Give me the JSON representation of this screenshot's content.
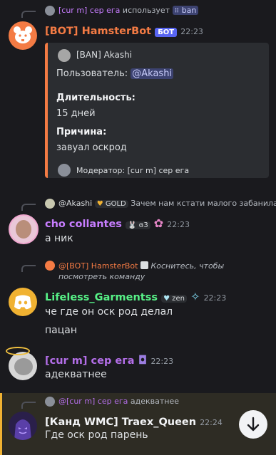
{
  "m1": {
    "reply_user": "[cur m] сер ега",
    "reply_text": "использует",
    "reply_cmd": "ban",
    "author": "[BOT] HamsterBot",
    "bot_badge": "БОТ",
    "time": "22:23",
    "embed": {
      "author": "[BAN] Akashi",
      "user_label": "Пользователь:",
      "user_mention": "@Akashi",
      "duration_label": "Длительность:",
      "duration_value": "15 дней",
      "reason_label": "Причина:",
      "reason_value": "завуал оскрод",
      "footer": "Модератор: [cur m] сер ега"
    }
  },
  "m2": {
    "reply_user": "@Akashi",
    "reply_tag": "GOLD",
    "reply_text": "Зачем нам кстати малого забанила",
    "author": "cho collantes",
    "tag": "ɞ3",
    "time": "22:23",
    "text": "а ник"
  },
  "m3": {
    "reply_user": "@[BOT] HamsterBot",
    "reply_text": "Коснитесь, чтобы посмотреть команду",
    "author": "Lifeless_Garmentss",
    "tag": "zen",
    "time": "22:23",
    "line1": "че где он оск род делал",
    "line2": "пацан"
  },
  "m4": {
    "author": "[cur m] сер ега",
    "time": "22:23",
    "text": "адекватнее"
  },
  "m5": {
    "reply_user": "@[cur m] сер ега",
    "reply_text": "адекватнее",
    "author": "[Канд WMC] Traex_Queen",
    "time": "22:24",
    "text": "Где оск род парень"
  },
  "colors": {
    "bot_name": "#f47b44",
    "embed_bar": "#f47b44",
    "mention_bg": "#3c4270",
    "mention_fg": "#c9cdfb",
    "cho": "#c77dff",
    "lifeless": "#57f287",
    "curm": "#b36ee8",
    "highlight_bg": "#2e2c24",
    "highlight_bar": "#f0b232"
  }
}
